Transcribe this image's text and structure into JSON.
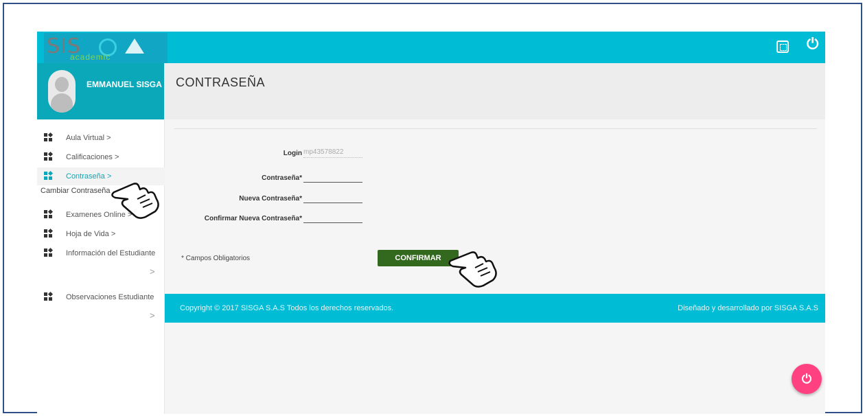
{
  "app": {
    "logo_text": "SIS",
    "logo_sub": "academic"
  },
  "topbar": {
    "fullscreen_icon": "fullscreen-icon",
    "power_icon": "power-icon"
  },
  "sidebar": {
    "user_name": "EMMANUEL SISGA",
    "items": [
      {
        "label": "Aula Virtual",
        "chevron": ">"
      },
      {
        "label": "Calificaciones",
        "chevron": ">"
      },
      {
        "label": "Contraseña",
        "chevron": ">"
      },
      {
        "label": "Examenes Online",
        "chevron": ">"
      },
      {
        "label": "Hoja de Vida",
        "chevron": ">"
      },
      {
        "label": "Información del Estudiante",
        "chevron": ">"
      },
      {
        "label": "Observaciones Estudiante",
        "chevron": ">"
      }
    ],
    "submenu": {
      "label": "Cambiar Contraseña"
    }
  },
  "main": {
    "title": "CONTRASEÑA",
    "form": {
      "login_label": "Login",
      "login_value": "mp43578822",
      "password_label": "Contraseña*",
      "new_password_label": "Nueva Contraseña*",
      "confirm_password_label": "Confirmar Nueva Contraseña*",
      "required_note": "* Campos Obligatorios",
      "confirm_button": "CONFIRMAR"
    }
  },
  "footer": {
    "copyright": "Copyright © 2017 SISGA S.A.S Todos los derechos reservados.",
    "credit": "Diseñado y desarrollado por SISGA S.A.S"
  },
  "colors": {
    "primary": "#00bcd4",
    "button": "#33691e",
    "fab": "#ff4081"
  }
}
